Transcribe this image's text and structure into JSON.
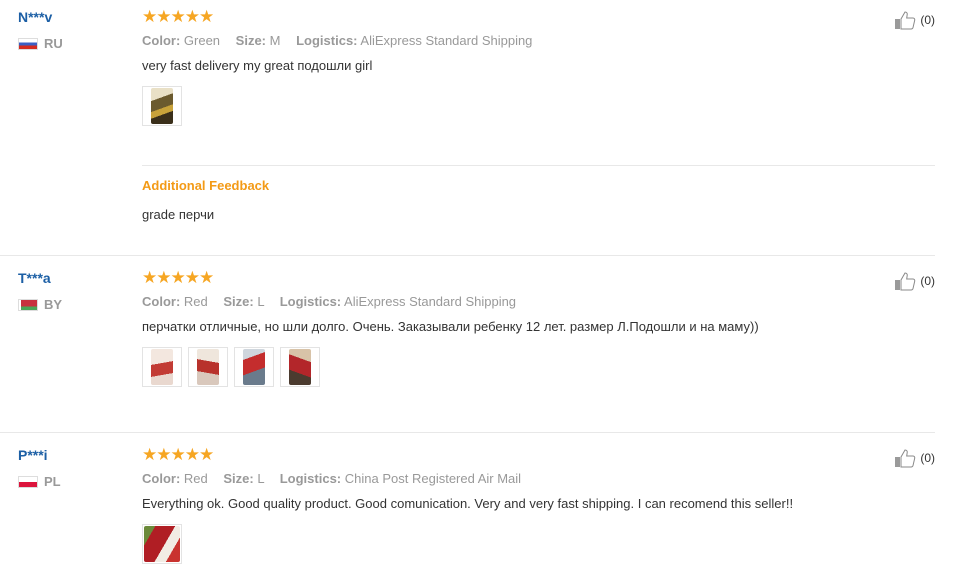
{
  "reviews": [
    {
      "user": "N***v",
      "country": "RU",
      "rating": 5,
      "stars": "★★★★★",
      "color_label": "Color:",
      "color": "Green",
      "size_label": "Size:",
      "size": "M",
      "logistics_label": "Logistics:",
      "logistics": "AliExpress Standard Shipping",
      "text": "very fast delivery my great подошли girl",
      "helpful": "(0)",
      "additional_title": "Additional Feedback",
      "additional_text": "grade перчи"
    },
    {
      "user": "T***a",
      "country": "BY",
      "rating": 5,
      "stars": "★★★★★",
      "color_label": "Color:",
      "color": "Red",
      "size_label": "Size:",
      "size": "L",
      "logistics_label": "Logistics:",
      "logistics": "AliExpress Standard Shipping",
      "text": "перчатки отличные, но шли долго. Очень. Заказывали ребенку 12 лет. размер Л.Подошли и на маму))",
      "helpful": "(0)"
    },
    {
      "user": "P***i",
      "country": "PL",
      "rating": 5,
      "stars": "★★★★★",
      "color_label": "Color:",
      "color": "Red",
      "size_label": "Size:",
      "size": "L",
      "logistics_label": "Logistics:",
      "logistics": "China Post Registered Air Mail",
      "text": "Everything ok. Good quality product. Good comunication. Very and very fast shipping. I can recomend this seller!!",
      "helpful": "(0)"
    }
  ],
  "colors": {
    "star": "#f6a623",
    "username": "#1c5fa5",
    "additional": "#f39a16"
  },
  "icons": {
    "helpful": "thumbs-up-icon"
  }
}
